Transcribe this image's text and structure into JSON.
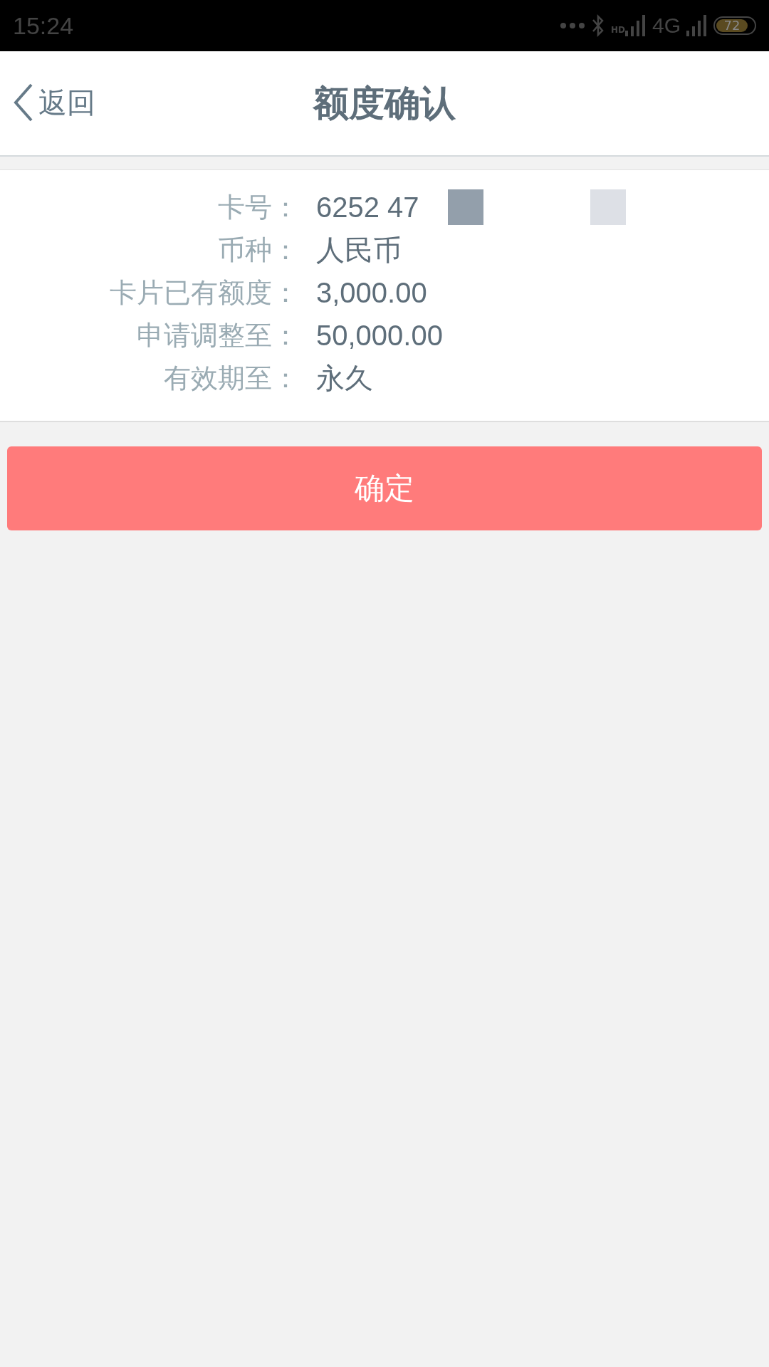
{
  "status_bar": {
    "time": "15:24",
    "network_badge": "HD",
    "network": "4G",
    "battery": "72"
  },
  "header": {
    "back": "返回",
    "title": "额度确认"
  },
  "details": [
    {
      "label": "卡号：",
      "value": "6252 47",
      "redacted": true
    },
    {
      "label": "币种：",
      "value": "人民币"
    },
    {
      "label": "卡片已有额度：",
      "value": "3,000.00"
    },
    {
      "label": "申请调整至：",
      "value": "50,000.00"
    },
    {
      "label": "有效期至：",
      "value": "永久"
    }
  ],
  "confirm_button": "确定"
}
